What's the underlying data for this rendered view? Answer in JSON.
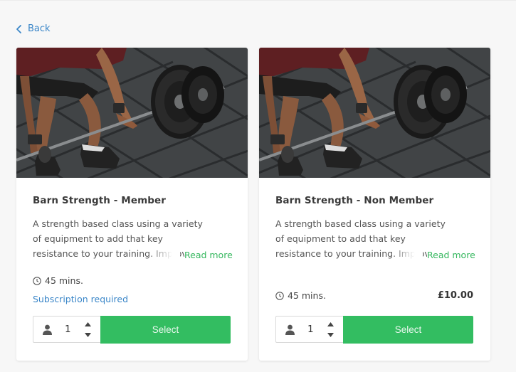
{
  "nav": {
    "back_label": "Back"
  },
  "colors": {
    "accent_green": "#33bd61",
    "link_blue": "#3a86c8"
  },
  "cards": [
    {
      "title": "Barn Strength - Member",
      "description": "A strength based class using a variety of equipment to add that key resistance to your training. Improving your strength",
      "read_more": "Read more",
      "duration": "45 mins.",
      "subscription_note": "Subscription required",
      "quantity": "1",
      "select_label": "Select",
      "image_icon": "barbell-deadlift-photo"
    },
    {
      "title": "Barn Strength - Non Member",
      "description": "A strength based class using a variety of equipment to add that key resistance to your training. Improving your strength",
      "read_more": "Read more",
      "duration": "45 mins.",
      "price": "£10.00",
      "quantity": "1",
      "select_label": "Select",
      "image_icon": "barbell-deadlift-photo"
    }
  ]
}
